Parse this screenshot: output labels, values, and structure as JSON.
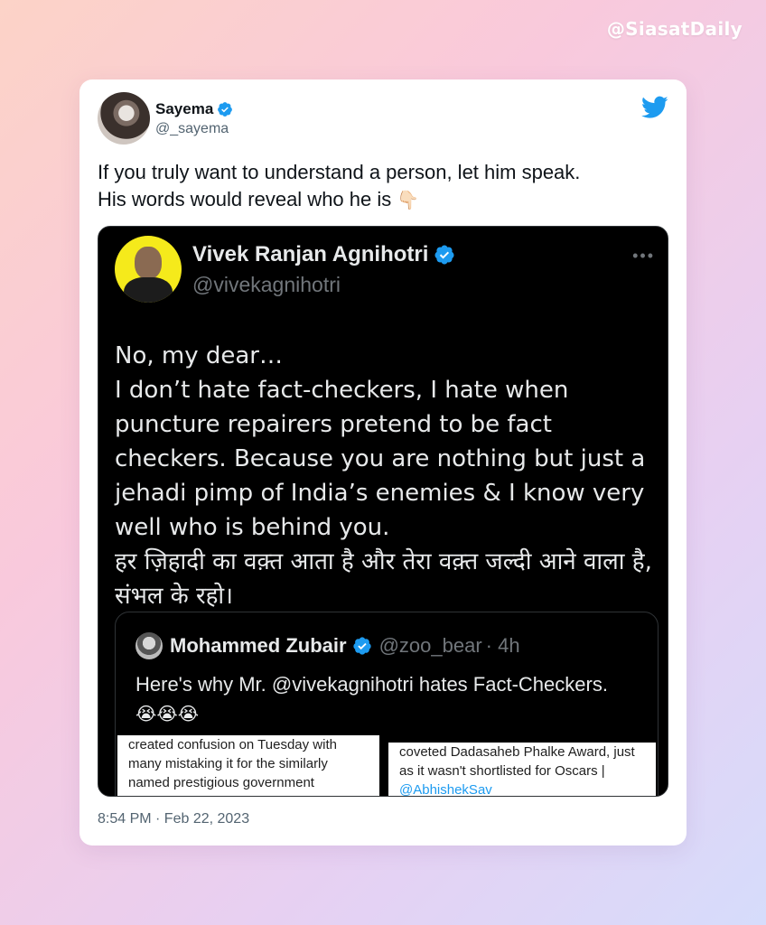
{
  "watermark": "@SiasatDaily",
  "tweet": {
    "author_name": "Sayema",
    "author_handle": "@_sayema",
    "text_line1": "If you truly want to understand a person, let him speak.",
    "text_line2": "His words would reveal who he is",
    "emoji": "👇🏻",
    "timestamp": "8:54 PM · Feb 22, 2023"
  },
  "embedded": {
    "author_name": "Vivek Ranjan Agnihotri",
    "author_handle": "@vivekagnihotri",
    "more": "•••",
    "text_line1": "No, my dear…",
    "text_line2": "I don’t hate fact-checkers, I hate when puncture repairers pretend to be fact checkers. Because you are nothing but just a jehadi pimp of India’s enemies & I know very well who is behind you.",
    "text_line3": "हर ज़िहादी का वक़्त आता है और तेरा वक़्त जल्दी आने वाला है, संभल के रहो।"
  },
  "quoted": {
    "author_name": "Mohammed Zubair",
    "author_handle": "@zoo_bear",
    "time": "· 4h",
    "text": "Here's why Mr. @vivekagnihotri hates Fact-Checkers.",
    "emojis": "😭😭😭",
    "image_left_text": "created confusion on Tuesday with many mistaking it for the similarly named prestigious government",
    "image_right_text": "coveted Dadasaheb Phalke Award, just as it wasn't shortlisted for Oscars |",
    "image_right_link": "@AbhishekSav"
  },
  "colors": {
    "verified": "#1d9bf0",
    "twitter_blue": "#1d9bf0",
    "dark_bg": "#000000"
  },
  "icons": {
    "twitter": "twitter-bird-icon",
    "verified": "verified-badge-icon",
    "more": "more-horizontal-icon"
  }
}
